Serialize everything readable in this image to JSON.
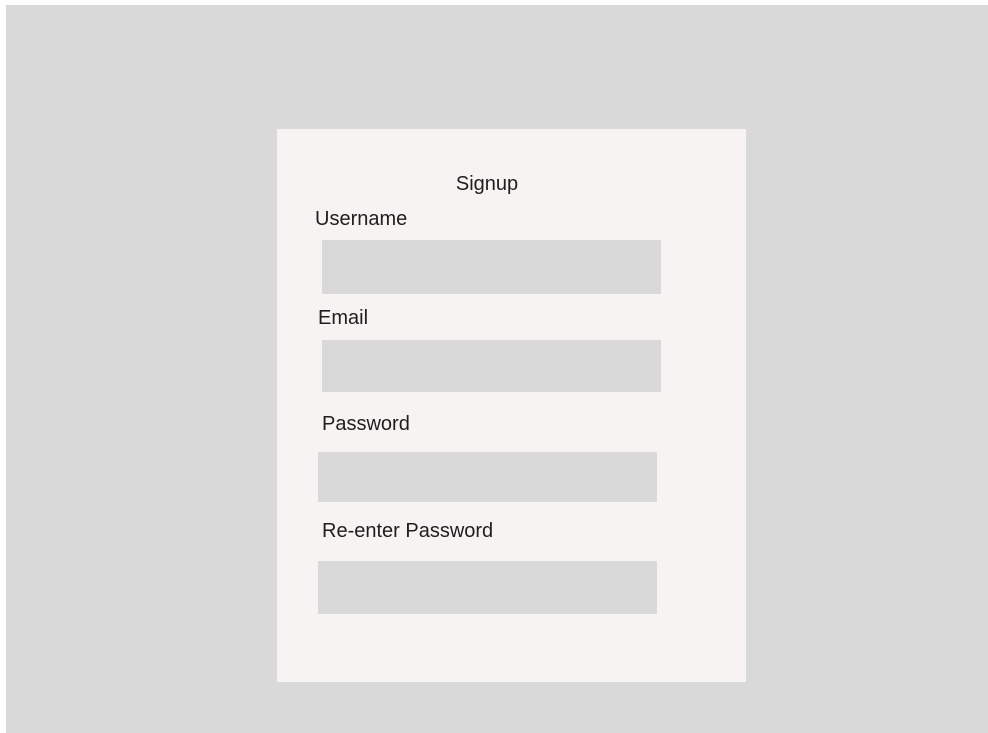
{
  "signup": {
    "title": "Signup",
    "fields": {
      "username": {
        "label": "Username",
        "value": "",
        "placeholder": ""
      },
      "email": {
        "label": "Email",
        "value": "",
        "placeholder": ""
      },
      "password": {
        "label": "Password",
        "value": "",
        "placeholder": ""
      },
      "reenter_password": {
        "label": "Re-enter Password",
        "value": "",
        "placeholder": ""
      }
    }
  },
  "colors": {
    "background": "#d9d9d9",
    "card": "#f7f3f3",
    "field": "#d9d9d9",
    "text": "#1e1e1e"
  }
}
